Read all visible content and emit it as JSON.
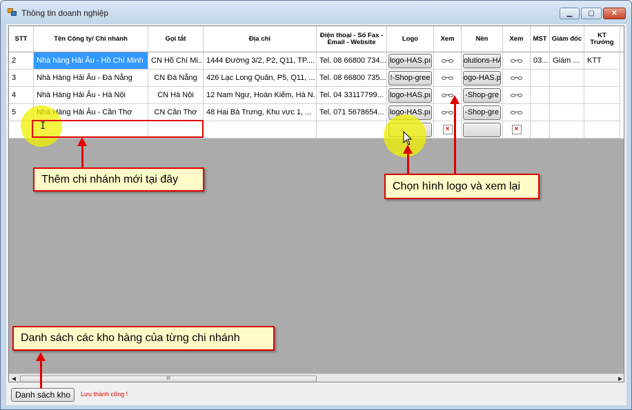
{
  "window": {
    "title": "Thông tin doanh nghiệp",
    "min_glyph": "▁",
    "max_glyph": "▢",
    "close_glyph": "✕"
  },
  "grid": {
    "columns": [
      {
        "key": "stt",
        "label": "STT"
      },
      {
        "key": "ten",
        "label": "Tên Công ty/ Chi nhánh"
      },
      {
        "key": "goitat",
        "label": "Gọi tắt"
      },
      {
        "key": "diachi",
        "label": "Địa chỉ"
      },
      {
        "key": "lienhe",
        "label": "Điện thoại - Số Fax - Email - Website"
      },
      {
        "key": "logo",
        "label": "Logo"
      },
      {
        "key": "xem1",
        "label": "Xem"
      },
      {
        "key": "nen",
        "label": "Nền"
      },
      {
        "key": "xem2",
        "label": "Xem"
      },
      {
        "key": "mst",
        "label": "MST"
      },
      {
        "key": "giamdoc",
        "label": "Giám đốc"
      },
      {
        "key": "ktt",
        "label": "KT Trưởng"
      }
    ],
    "rows": [
      {
        "stt": "2",
        "ten": "Nhà hàng Hải Âu - Hồ Chí Minh",
        "goitat": "CN Hồ Chí Mi...",
        "diachi": "1444 Đường 3/2, P2, Q11, TP....",
        "lienhe": "Tel. 08 66800 734...",
        "logo": "logo-HAS.pı",
        "nen": "olutions-HA",
        "mst": "03...",
        "giamdoc": "Giám ...",
        "ktt": "KTT"
      },
      {
        "stt": "3",
        "ten": "Nhà Hàng Hải Âu - Đà Nẵng",
        "goitat": "CN Đà Nẵng",
        "diachi": "426 Lạc Long Quân, P5, Q11, ...",
        "lienhe": "Tel. 08 66800 735...",
        "logo": "!-Shop-gree",
        "nen": "ogo-HAS.p",
        "mst": "",
        "giamdoc": "",
        "ktt": ""
      },
      {
        "stt": "4",
        "ten": "Nhà Hàng Hải Âu - Hà Nội",
        "goitat": "CN Hà Nội",
        "diachi": "12 Nam Ngư, Hoàn Kiếm, Hà N...",
        "lienhe": "Tel. 04 33117799...",
        "logo": "logo-HAS.pı",
        "nen": "-Shop-gre",
        "mst": "",
        "giamdoc": "",
        "ktt": ""
      },
      {
        "stt": "5",
        "ten": "Nhà Hàng Hải Âu - Cần Thơ",
        "goitat": "CN Cần Thơ",
        "diachi": "48 Hai Bà Trưng, Khu vực 1, ...",
        "lienhe": "Tel. 071 5678654...",
        "logo": "logo-HAS.pı",
        "nen": "-Shop-gre",
        "mst": "",
        "giamdoc": "",
        "ktt": ""
      }
    ],
    "new_row_broken_glyph": "×",
    "scroll_left": "◀",
    "scroll_right": "▶",
    "scroll_grip": "III"
  },
  "footer": {
    "kho_button_label": "Danh sách kho",
    "status": "Lưu thành công !"
  },
  "annotations": {
    "add_branch": "Thêm chi nhánh mới tại đây",
    "choose_logo": "Chọn hình logo và xem lại",
    "warehouse_list": "Danh sách các kho hàng của từng chi nhánh"
  },
  "colors": {
    "selection": "#3399ff",
    "callout_border": "#e00000",
    "callout_bg": "#fffbc8",
    "status_text": "#e00000"
  }
}
